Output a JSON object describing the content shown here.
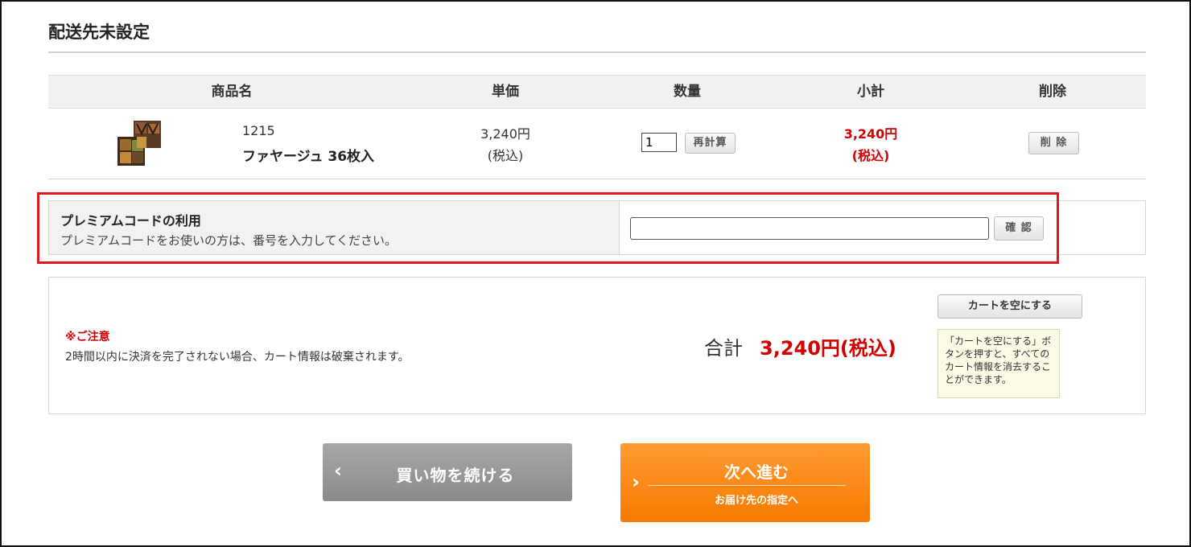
{
  "page": {
    "section_title": "配送先未設定"
  },
  "cart": {
    "headers": {
      "product_name": "商品名",
      "unit_price": "単価",
      "quantity": "数量",
      "subtotal": "小計",
      "delete": "削除"
    },
    "items": [
      {
        "code": "1215",
        "name": "ファヤージュ 36枚入",
        "unit_price": "3,240円",
        "unit_price_tax": "(税込)",
        "quantity": "1",
        "recalc_label": "再計算",
        "subtotal": "3,240円",
        "subtotal_tax": "(税込)",
        "delete_label": "削 除"
      }
    ]
  },
  "premium": {
    "title": "プレミアムコードの利用",
    "description": "プレミアムコードをお使いの方は、番号を入力してください。",
    "input_value": "",
    "confirm_label": "確 認"
  },
  "summary": {
    "notice_title": "※ご注意",
    "notice_text": "2時間以内に決済を完了されない場合、カート情報は破棄されます。",
    "total_label": "合計",
    "total_value": "3,240円(税込)",
    "empty_cart_label": "カートを空にする",
    "empty_cart_hint": "「カートを空にする」ボタンを押すと、すべてのカート情報を消去することができます。"
  },
  "actions": {
    "continue_label": "買い物を続ける",
    "next_label": "次へ進む",
    "next_sub_label": "お届け先の指定へ"
  },
  "colors": {
    "accent_red": "#d40000",
    "highlight_red": "#e0161b",
    "next_orange": "#f77a00",
    "continue_gray": "#8a8a8a"
  }
}
